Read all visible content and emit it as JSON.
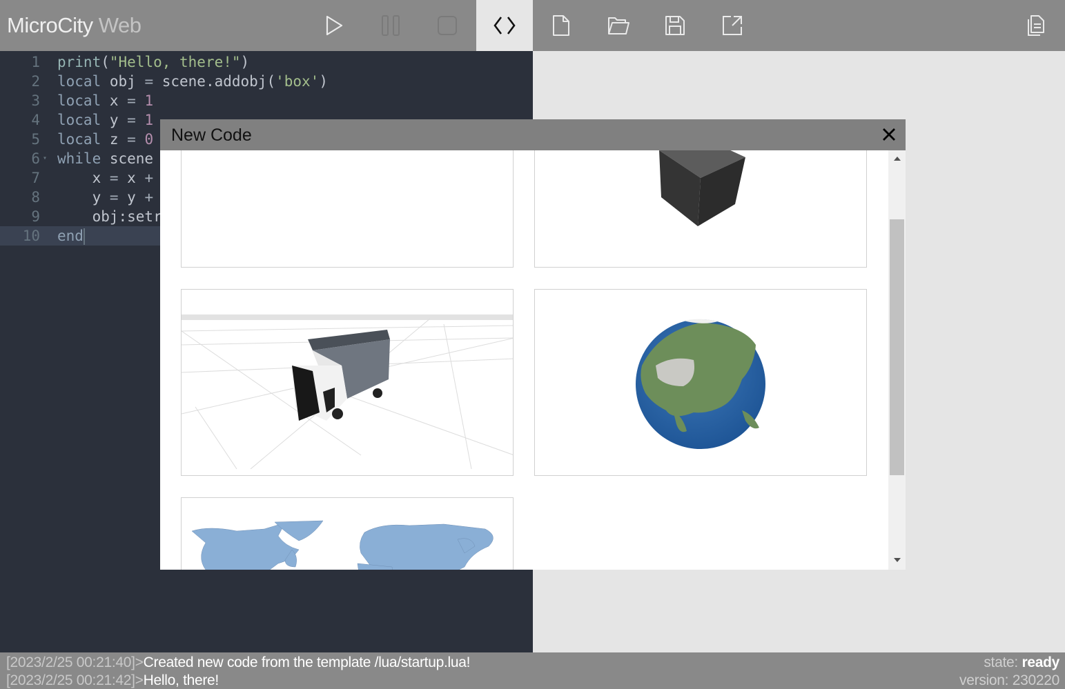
{
  "app": {
    "title_main": "MicroCity",
    "title_sub": " Web"
  },
  "toolbar": {
    "buttons": [
      {
        "name": "run",
        "icon": "play-icon",
        "active": false,
        "enabled": true
      },
      {
        "name": "pause",
        "icon": "pause-icon",
        "active": false,
        "enabled": false
      },
      {
        "name": "stop",
        "icon": "stop-icon",
        "active": false,
        "enabled": false
      },
      {
        "name": "code-editor",
        "icon": "code-icon",
        "active": true,
        "enabled": true
      },
      {
        "name": "new-file",
        "icon": "new-file-icon",
        "active": false,
        "enabled": true
      },
      {
        "name": "open-folder",
        "icon": "folder-open-icon",
        "active": false,
        "enabled": true
      },
      {
        "name": "save",
        "icon": "save-icon",
        "active": false,
        "enabled": true
      },
      {
        "name": "export",
        "icon": "external-link-icon",
        "active": false,
        "enabled": true
      },
      {
        "name": "docs",
        "icon": "copy-document-icon",
        "active": false,
        "enabled": true
      }
    ]
  },
  "editor": {
    "current_line": 10,
    "lines": [
      {
        "n": "1",
        "text": "print(\"Hello, there!\")"
      },
      {
        "n": "2",
        "text": "local obj = scene.addobj('box')"
      },
      {
        "n": "3",
        "text": "local x = 1"
      },
      {
        "n": "4",
        "text": "local y = 1"
      },
      {
        "n": "5",
        "text": "local z = 0"
      },
      {
        "n": "6",
        "text": "while scene",
        "fold": true
      },
      {
        "n": "7",
        "text": "    x = x +"
      },
      {
        "n": "8",
        "text": "    y = y +"
      },
      {
        "n": "9",
        "text": "    obj:setr"
      },
      {
        "n": "10",
        "text": "end"
      }
    ]
  },
  "modal": {
    "title": "New Code",
    "close_icon": "close-icon",
    "templates": [
      {
        "name": "empty-template",
        "preview": "blank"
      },
      {
        "name": "box-template",
        "preview": "3d-box"
      },
      {
        "name": "truck-template",
        "preview": "3d-truck-on-grid"
      },
      {
        "name": "earth-template",
        "preview": "globe-asia"
      },
      {
        "name": "world-map-template",
        "preview": "world-map"
      }
    ],
    "scroll_position": 0.16
  },
  "log": {
    "entries": [
      {
        "time": "[2023/2/25 00:21:40]",
        "sep": ">",
        "message": "Created new code from the template /lua/startup.lua!"
      },
      {
        "time": "[2023/2/25 00:21:42]",
        "sep": ">",
        "message": "Hello, there!"
      }
    ]
  },
  "status": {
    "state_label": "state: ",
    "state_value": "ready",
    "version_label": "version: ",
    "version_value": "230220"
  },
  "colors": {
    "toolbar_bg": "#898989",
    "editor_bg": "#2b303b",
    "keyword": "#8fa1b3",
    "string": "#a3be8c",
    "number": "#b48ead",
    "map_blue": "#8aafd6",
    "ocean_blue": "#2d67a8"
  }
}
